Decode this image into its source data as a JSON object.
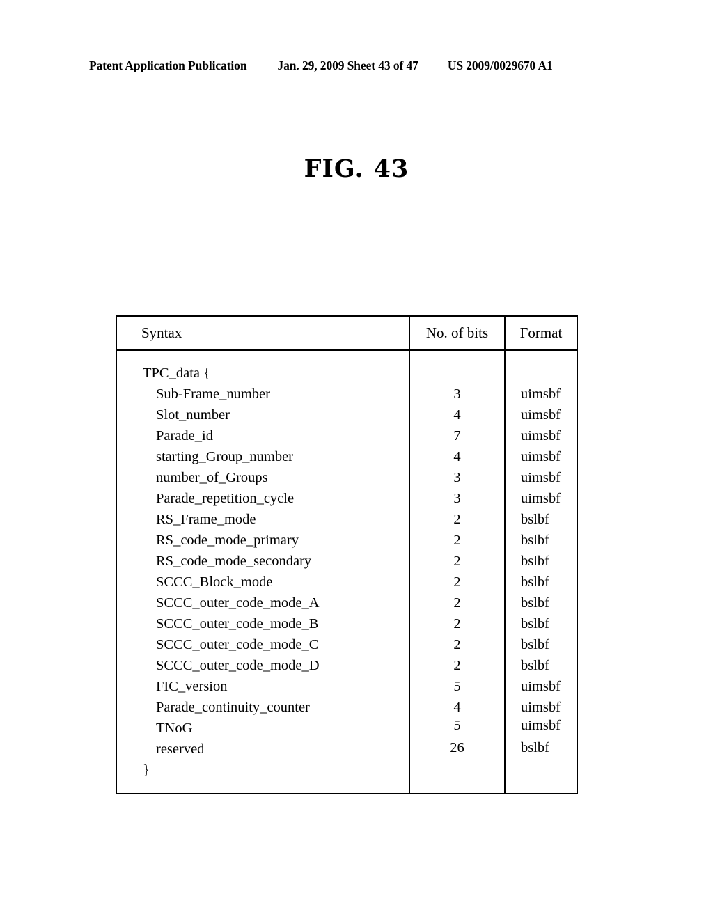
{
  "header": {
    "publication": "Patent Application Publication",
    "date_sheet": "Jan. 29, 2009  Sheet 43 of 47",
    "patent_number": "US 2009/0029670 A1"
  },
  "figure": {
    "label": "FIG.",
    "number": "43"
  },
  "table": {
    "columns": [
      "Syntax",
      "No. of bits",
      "Format"
    ],
    "rows": [
      {
        "syntax": "TPC_data {",
        "indent": false,
        "bits": "",
        "format": ""
      },
      {
        "syntax": "Sub-Frame_number",
        "indent": true,
        "bits": "3",
        "format": "uimsbf"
      },
      {
        "syntax": "Slot_number",
        "indent": true,
        "bits": "4",
        "format": "uimsbf"
      },
      {
        "syntax": "Parade_id",
        "indent": true,
        "bits": "7",
        "format": "uimsbf"
      },
      {
        "syntax": "starting_Group_number",
        "indent": true,
        "bits": "4",
        "format": "uimsbf"
      },
      {
        "syntax": "number_of_Groups",
        "indent": true,
        "bits": "3",
        "format": "uimsbf"
      },
      {
        "syntax": "Parade_repetition_cycle",
        "indent": true,
        "bits": "3",
        "format": "uimsbf"
      },
      {
        "syntax": "RS_Frame_mode",
        "indent": true,
        "bits": "2",
        "format": "bslbf"
      },
      {
        "syntax": "RS_code_mode_primary",
        "indent": true,
        "bits": "2",
        "format": "bslbf"
      },
      {
        "syntax": "RS_code_mode_secondary",
        "indent": true,
        "bits": "2",
        "format": "bslbf"
      },
      {
        "syntax": "SCCC_Block_mode",
        "indent": true,
        "bits": "2",
        "format": "bslbf"
      },
      {
        "syntax": "SCCC_outer_code_mode_A",
        "indent": true,
        "bits": "2",
        "format": "bslbf"
      },
      {
        "syntax": "SCCC_outer_code_mode_B",
        "indent": true,
        "bits": "2",
        "format": "bslbf"
      },
      {
        "syntax": "SCCC_outer_code_mode_C",
        "indent": true,
        "bits": "2",
        "format": "bslbf"
      },
      {
        "syntax": "SCCC_outer_code_mode_D",
        "indent": true,
        "bits": "2",
        "format": "bslbf"
      },
      {
        "syntax": "FIC_version",
        "indent": true,
        "bits": "5",
        "format": "uimsbf"
      },
      {
        "syntax": "Parade_continuity_counter",
        "indent": true,
        "bits": "4",
        "format": "uimsbf"
      },
      {
        "syntax": "TNoG",
        "indent": true,
        "bits": "5",
        "format": "uimsbf"
      },
      {
        "syntax": "reserved",
        "indent": true,
        "bits": "26",
        "format": "bslbf"
      },
      {
        "syntax": "}",
        "indent": false,
        "bits": "",
        "format": ""
      }
    ]
  }
}
